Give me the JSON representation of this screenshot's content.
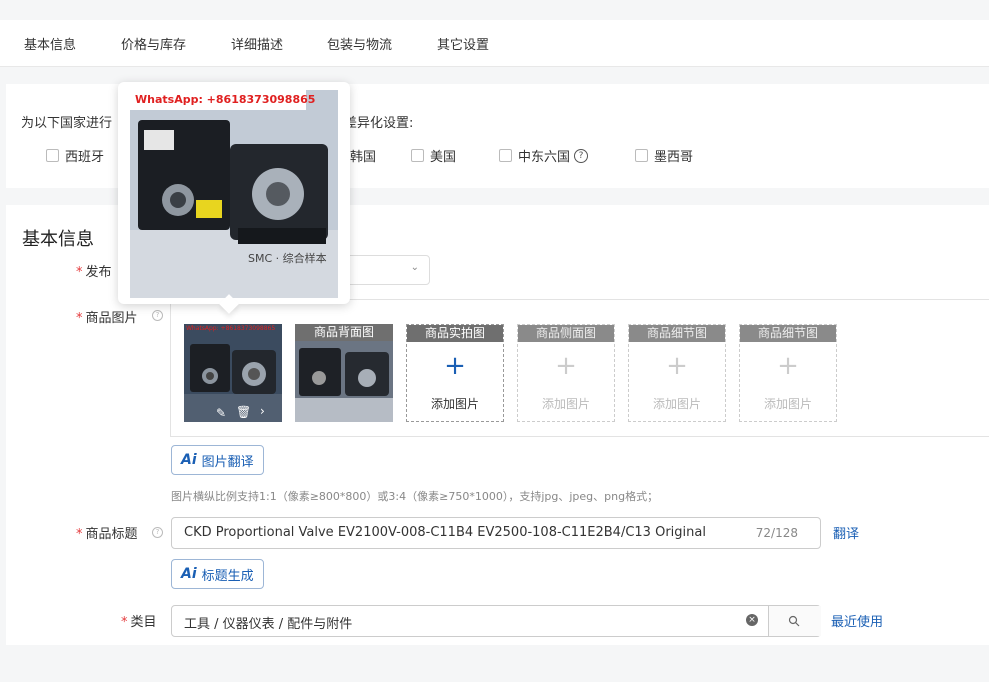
{
  "tabs": [
    "基本信息",
    "价格与库存",
    "详细描述",
    "包装与物流",
    "其它设置"
  ],
  "country": {
    "prompt_left": "为以下国家进行",
    "prompt_right": "差异化设置:",
    "options": [
      {
        "label": "西班牙",
        "checked": false
      },
      {
        "label": "韩国",
        "checked": false
      },
      {
        "label": "美国",
        "checked": false
      },
      {
        "label": "中东六国",
        "checked": false,
        "help": "?"
      },
      {
        "label": "墨西哥",
        "checked": false
      }
    ]
  },
  "basic": {
    "title": "基本信息",
    "publish_label": "发布",
    "images_label": "商品图片",
    "image_slots": [
      {
        "head": "",
        "add": "",
        "state": "uploaded"
      },
      {
        "head": "商品背面图",
        "add": "",
        "state": "uploaded"
      },
      {
        "head": "商品实拍图",
        "add": "添加图片",
        "state": "active"
      },
      {
        "head": "商品侧面图",
        "add": "添加图片",
        "state": "disabled"
      },
      {
        "head": "商品细节图",
        "add": "添加图片",
        "state": "disabled"
      },
      {
        "head": "商品细节图",
        "add": "添加图片",
        "state": "disabled"
      }
    ],
    "watermark_small": "WhatsApp: +8618373098865",
    "image_translate_btn": "图片翻译",
    "image_hint": "图片横纵比例支持1:1（像素≥800*800）或3:4（像素≥750*1000），支持jpg、jpeg、png格式；",
    "title_label": "商品标题",
    "title_value": "CKD Proportional Valve EV2100V-008-C11B4 EV2500-108-C11E2B4/C13 Original",
    "title_count": "72/128",
    "translate_link": "翻译",
    "title_gen_btn": "标题生成",
    "category_label": "类目",
    "category_value": "工具 / 仪器仪表 / 配件与附件",
    "recent_link": "最近使用"
  },
  "popover": {
    "watermark": "WhatsApp: +8618373098865",
    "photo_text": "SMC · 综合样本"
  },
  "colors": {
    "accent": "#1a5fb4",
    "required": "#e4393c",
    "watermark": "#e02020"
  }
}
